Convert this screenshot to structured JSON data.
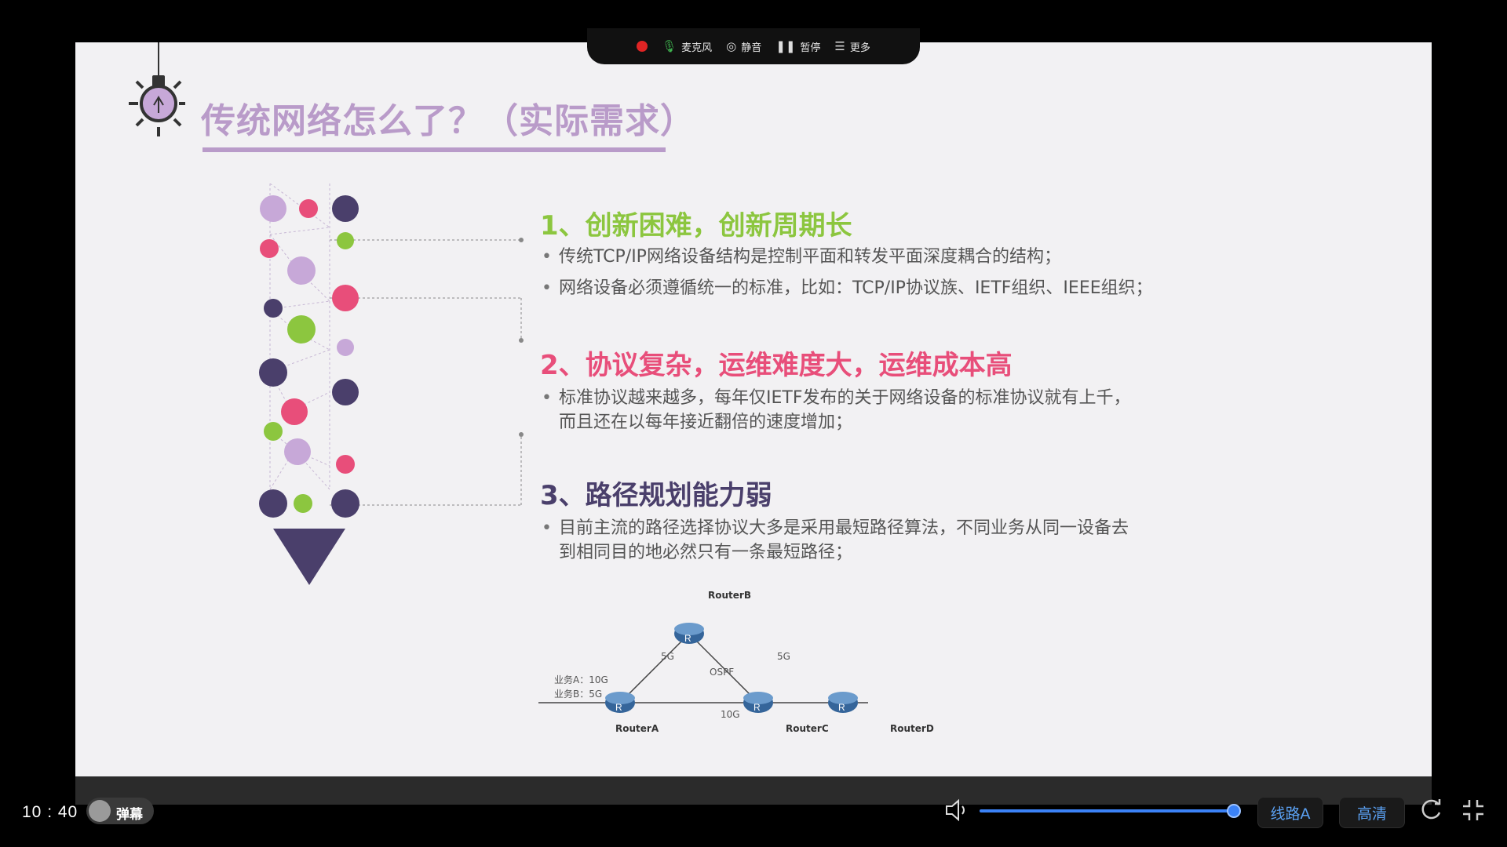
{
  "toolbar": {
    "mic_label": "麦克风",
    "mute_label": "静音",
    "pause_label": "暂停",
    "more_label": "更多"
  },
  "slide": {
    "title": "传统网络怎么了？（实际需求）",
    "sections": [
      {
        "heading": "1、创新困难，创新周期长",
        "bullets": [
          "传统TCP/IP网络设备结构是控制平面和转发平面深度耦合的结构；",
          "网络设备必须遵循统一的标准，比如：TCP/IP协议族、IETF组织、IEEE组织；"
        ]
      },
      {
        "heading": "2、协议复杂，运维难度大，运维成本高",
        "bullets": [
          "标准协议越来越多，每年仅IETF发布的关于网络设备的标准协议就有上千，",
          "而且还在以每年接近翻倍的速度增加；"
        ]
      },
      {
        "heading": "3、路径规划能力弱",
        "bullets": [
          "目前主流的路径选择协议大多是采用最短路径算法，不同业务从同一设备去",
          "到相同目的地必然只有一条最短路径；"
        ]
      }
    ],
    "network": {
      "routers": [
        "RouterA",
        "RouterB",
        "RouterC",
        "RouterD"
      ],
      "link_ab": "5G",
      "link_bc": "5G",
      "link_ac": "10G",
      "protocol": "OSPF",
      "service_a": "业务A：10G",
      "service_b": "业务B：5G"
    }
  },
  "player": {
    "time": "10 : 40",
    "danmu_label": "弹幕",
    "line_label": "线路A",
    "quality_label": "高清",
    "volume_percent": 100
  },
  "colors": {
    "title": "#b99bc9",
    "section1": "#8cc63f",
    "section2": "#e84e7a",
    "section3": "#4a3f6b",
    "accent_blue": "#3b82f6"
  }
}
